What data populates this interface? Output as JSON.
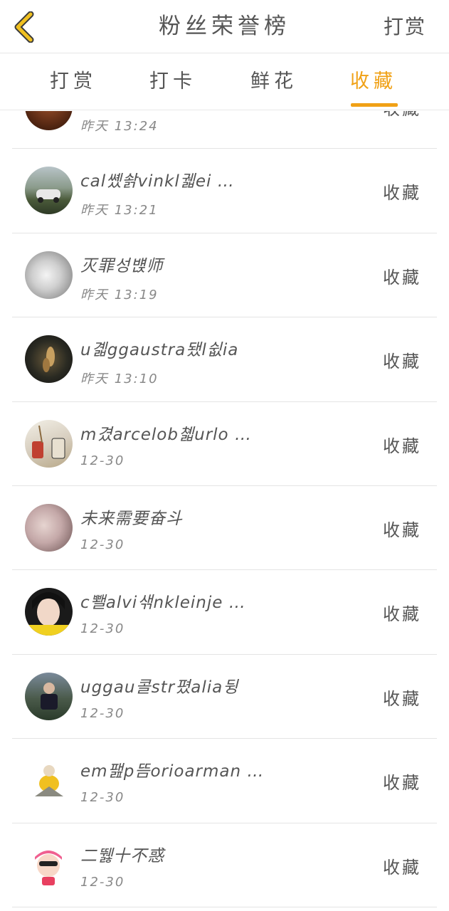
{
  "header": {
    "title": "粉丝荣誉榜",
    "action_label": "打赏",
    "back_icon": "chevron-left-icon",
    "back_color": "#f0c020"
  },
  "tabs": [
    {
      "label": "打赏",
      "active": false
    },
    {
      "label": "打卡",
      "active": false
    },
    {
      "label": "鲜花",
      "active": false
    },
    {
      "label": "收藏",
      "active": true
    }
  ],
  "accent_color": "#f0a116",
  "rows": [
    {
      "name": "",
      "time": "昨天 13:24",
      "action": "收藏"
    },
    {
      "name": "cal쏐솱vinkl궯ei …",
      "time": "昨天 13:21",
      "action": "收藏"
    },
    {
      "name": "灭罪성뱭师",
      "time": "昨天 13:19",
      "action": "收藏"
    },
    {
      "name": "u곏ggaustra됐l쉾ia",
      "time": "昨天 13:10",
      "action": "收藏"
    },
    {
      "name": "m겼arcelob쳷urlo …",
      "time": "12-30",
      "action": "收藏"
    },
    {
      "name": "未来需要奋斗",
      "time": "12-30",
      "action": "收藏"
    },
    {
      "name": "c뾀alvi샊nkleinje …",
      "time": "12-30",
      "action": "收藏"
    },
    {
      "name": "uggau콜str폈alia뒹",
      "time": "12-30",
      "action": "收藏"
    },
    {
      "name": "em팶p뜸orioarman …",
      "time": "12-30",
      "action": "收藏"
    },
    {
      "name": "二뛣十不惑",
      "time": "12-30",
      "action": "收藏"
    }
  ]
}
